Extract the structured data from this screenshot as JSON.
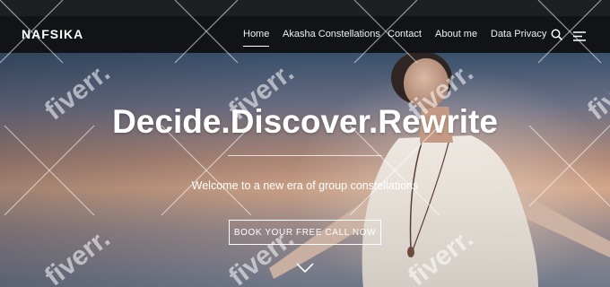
{
  "header": {
    "logo": "NAFSIKA",
    "nav": [
      {
        "label": "Home",
        "active": true
      },
      {
        "label": "Akasha Constellations",
        "active": false
      },
      {
        "label": "Contact",
        "active": false
      },
      {
        "label": "About me",
        "active": false
      },
      {
        "label": "Data Privacy",
        "active": false
      }
    ],
    "icons": [
      "search-icon",
      "menu-icon"
    ]
  },
  "hero": {
    "headline": "Decide.Discover.Rewrite",
    "subtitle": "Welcome to a new era of group constellations",
    "cta_label": "BOOK YOUR FREE CALL NOW",
    "scroll_icon": "chevron-down-icon"
  },
  "watermark": {
    "text": "fiverr."
  },
  "colors": {
    "navbar_bg": "#121316",
    "text": "#ffffff",
    "accent_line": "#ffffff"
  }
}
